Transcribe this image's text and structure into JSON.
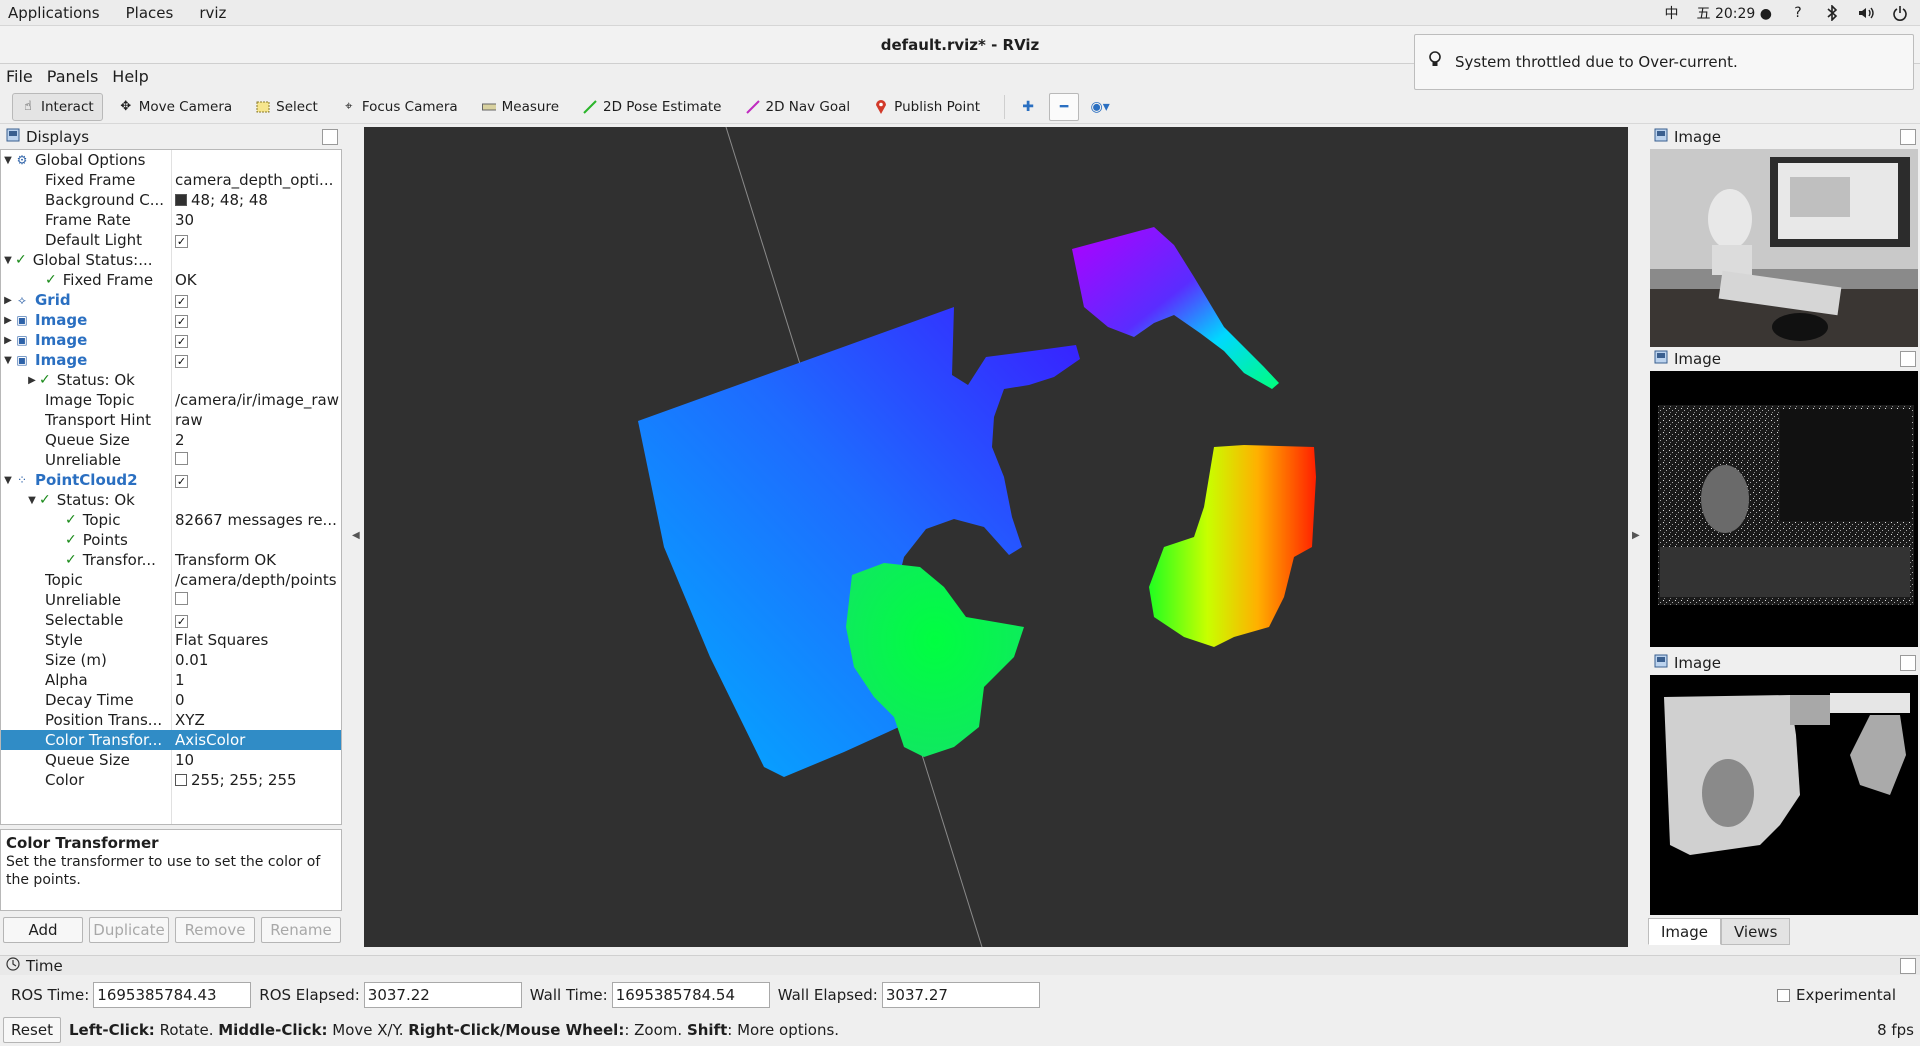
{
  "topbar": {
    "menus": [
      "Applications",
      "Places",
      "rviz"
    ],
    "input_method": "中",
    "clock": "五 20:29",
    "icons": [
      "help-icon",
      "bluetooth-icon",
      "volume-icon",
      "power-icon"
    ]
  },
  "window": {
    "title": "default.rviz* - RViz"
  },
  "notification": {
    "text": "System throttled due to Over-current."
  },
  "menubar": [
    "File",
    "Panels",
    "Help"
  ],
  "toolbar": {
    "tools": [
      {
        "label": "Interact",
        "icon": "hand-icon",
        "active": true
      },
      {
        "label": "Move Camera",
        "icon": "move-camera-icon"
      },
      {
        "label": "Select",
        "icon": "select-icon"
      },
      {
        "label": "Focus Camera",
        "icon": "focus-camera-icon"
      },
      {
        "label": "Measure",
        "icon": "measure-icon"
      },
      {
        "label": "2D Pose Estimate",
        "icon": "pose-estimate-icon"
      },
      {
        "label": "2D Nav Goal",
        "icon": "nav-goal-icon"
      },
      {
        "label": "Publish Point",
        "icon": "publish-point-icon"
      }
    ]
  },
  "displays": {
    "title": "Displays",
    "rows": [
      {
        "a": "Global Options",
        "b": ""
      },
      {
        "a": "Fixed Frame",
        "b": "camera_depth_opti..."
      },
      {
        "a": "Background C...",
        "b": "48; 48; 48"
      },
      {
        "a": "Frame Rate",
        "b": "30"
      },
      {
        "a": "Default Light",
        "b": ""
      },
      {
        "a": "Global Status:...",
        "b": ""
      },
      {
        "a": "Fixed Frame",
        "b": "OK"
      },
      {
        "a": "Grid",
        "b": ""
      },
      {
        "a": "Image",
        "b": ""
      },
      {
        "a": "Image",
        "b": ""
      },
      {
        "a": "Image",
        "b": ""
      },
      {
        "a": "Status: Ok",
        "b": ""
      },
      {
        "a": "Image Topic",
        "b": "/camera/ir/image_raw"
      },
      {
        "a": "Transport Hint",
        "b": "raw"
      },
      {
        "a": "Queue Size",
        "b": "2"
      },
      {
        "a": "Unreliable",
        "b": ""
      },
      {
        "a": "PointCloud2",
        "b": ""
      },
      {
        "a": "Status: Ok",
        "b": ""
      },
      {
        "a": "Topic",
        "b": "82667 messages re..."
      },
      {
        "a": "Points",
        "b": ""
      },
      {
        "a": "Transfor...",
        "b": "Transform OK"
      },
      {
        "a": "Topic",
        "b": "/camera/depth/points"
      },
      {
        "a": "Unreliable",
        "b": ""
      },
      {
        "a": "Selectable",
        "b": ""
      },
      {
        "a": "Style",
        "b": "Flat Squares"
      },
      {
        "a": "Size (m)",
        "b": "0.01"
      },
      {
        "a": "Alpha",
        "b": "1"
      },
      {
        "a": "Decay Time",
        "b": "0"
      },
      {
        "a": "Position Trans...",
        "b": "XYZ"
      },
      {
        "a": "Color Transfor...",
        "b": "AxisColor"
      },
      {
        "a": "Queue Size",
        "b": "10"
      },
      {
        "a": "Color",
        "b": "255; 255; 255"
      }
    ],
    "description_title": "Color Transformer",
    "description_text": "Set the transformer to use to set the color of the points.",
    "buttons": {
      "add": "Add",
      "duplicate": "Duplicate",
      "remove": "Remove",
      "rename": "Rename"
    }
  },
  "right_panel": {
    "image_titles": [
      "Image",
      "Image",
      "Image"
    ],
    "tabs": [
      "Image",
      "Views"
    ]
  },
  "time": {
    "title": "Time",
    "ros_time_label": "ROS Time:",
    "ros_time": "1695385784.43",
    "ros_elapsed_label": "ROS Elapsed:",
    "ros_elapsed": "3037.22",
    "wall_time_label": "Wall Time:",
    "wall_time": "1695385784.54",
    "wall_elapsed_label": "Wall Elapsed:",
    "wall_elapsed": "3037.27",
    "experimental_label": "Experimental",
    "reset_label": "Reset",
    "hint_left_click": "Left-Click:",
    "hint_rotate": " Rotate. ",
    "hint_middle_click": "Middle-Click:",
    "hint_move": " Move X/Y. ",
    "hint_right_click": "Right-Click/Mouse Wheel:",
    "hint_zoom": ": Zoom. ",
    "hint_shift": "Shift",
    "hint_more": ": More options.",
    "fps": "8 fps"
  },
  "colors": {
    "selection": "#308cc6",
    "view_background": "#303030",
    "status_ok": "#1a8a1a"
  }
}
